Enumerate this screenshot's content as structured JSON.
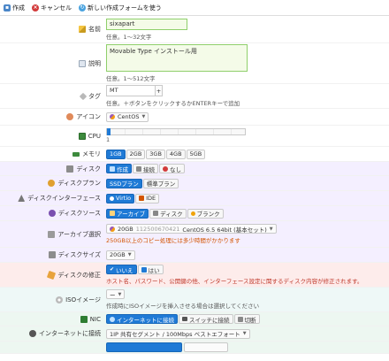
{
  "toolbar": {
    "save_label": "作成",
    "cancel_label": "キャンセル",
    "new_form_label": "新しい作成フォームを使う"
  },
  "name": {
    "label": "名前",
    "value": "sixapart",
    "hint": "任意。1〜32文字"
  },
  "description": {
    "label": "説明",
    "value": "Movable Type インストール用",
    "hint": "任意。1〜512文字"
  },
  "tags": {
    "label": "タグ",
    "value": "MT",
    "plus_label": "+",
    "hint": "任意。＋ボタンをクリックするかENTERキーで追加"
  },
  "icon_field": {
    "label": "アイコン",
    "selected": "CentOS"
  },
  "cpu": {
    "label": "CPU",
    "value": "1",
    "level": 0
  },
  "memory": {
    "label": "メモリ",
    "options": [
      "1GB",
      "2GB",
      "3GB",
      "4GB",
      "5GB"
    ],
    "selected": "1GB"
  },
  "disk": {
    "label": "ディスク",
    "options": [
      "作成",
      "接続",
      "なし"
    ],
    "selected": "作成"
  },
  "disk_plan": {
    "label": "ディスクプラン",
    "options": [
      "SSDプラン",
      "標準プラン"
    ],
    "selected": "SSDプラン"
  },
  "disk_interface": {
    "label": "ディスクインターフェース",
    "options": [
      "Virtio",
      "IDE"
    ],
    "selected": "Virtio"
  },
  "disk_source": {
    "label": "ディスクソース",
    "options": [
      "アーカイブ",
      "ディスク",
      "ブランク"
    ],
    "selected": "アーカイブ"
  },
  "archive": {
    "label": "アーカイブ選択",
    "size": "20GB",
    "id": "112500670421",
    "name": "CentOS 6.5 64bit (基本セット)",
    "hint": "250GB以上のコピー処理には多少時間がかかります"
  },
  "disk_size": {
    "label": "ディスクサイズ",
    "selected": "20GB"
  },
  "disk_modify": {
    "label": "ディスクの修正",
    "options": [
      "いいえ",
      "はい"
    ],
    "selected": "いいえ",
    "hint": "ホスト名、パスワード、公開鍵の他、インターフェース設定に関するディスク内容が修正されます。"
  },
  "iso": {
    "label": "ISOイメージ",
    "selected": "ー",
    "hint": "作成時にISOイメージを挿入させる場合は選択してください"
  },
  "nic": {
    "label": "NIC",
    "options": [
      "インターネットに接続",
      "スイッチに接続",
      "切断"
    ],
    "selected": "インターネットに接続"
  },
  "internet": {
    "label": "インターネットに接続",
    "selected": "1IP 共有セグメント / 100Mbps ベストエフォート"
  },
  "colors": {
    "accent": "#1f7ad6",
    "disk_section": "#f4efff",
    "warning_section": "#fdeceb",
    "iso_section": "#eef8f7",
    "nic_section": "#edf7f1"
  }
}
